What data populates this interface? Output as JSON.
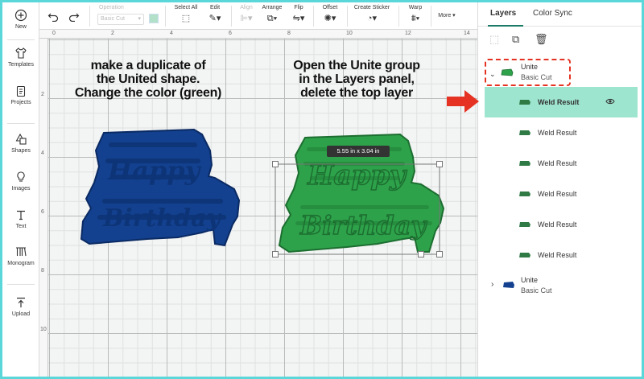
{
  "rail": {
    "new": "New",
    "templates": "Templates",
    "projects": "Projects",
    "shapes": "Shapes",
    "images": "Images",
    "text": "Text",
    "monogram": "Monogram",
    "upload": "Upload"
  },
  "toolbar": {
    "operation_label": "Operation",
    "operation_value": "Basic Cut",
    "select_all": "Select All",
    "edit": "Edit",
    "align": "Align",
    "arrange": "Arrange",
    "flip": "Flip",
    "offset": "Offset",
    "create_sticker": "Create Sticker",
    "warp": "Warp",
    "more": "More ▾"
  },
  "ruler": {
    "top": [
      "0",
      "2",
      "4",
      "6",
      "8",
      "10",
      "12",
      "14"
    ],
    "left": [
      "2",
      "4",
      "6",
      "8",
      "10"
    ]
  },
  "canvas": {
    "instruction_left": [
      "make a duplicate of",
      "the United shape.",
      "Change the color (green)"
    ],
    "instruction_right": [
      "Open the Unite group",
      "in the Layers panel,",
      "delete the top layer"
    ],
    "dimension_tooltip": "5.55  in x 3.04  in",
    "design_word_1": "Happy",
    "design_word_2": "Birthday"
  },
  "colors": {
    "navy": "#13418f",
    "green": "#2ea24a",
    "highlight": "#9ee5cf",
    "accent": "#1a7a66",
    "annotation_red": "#e53222"
  },
  "panel": {
    "tab_layers": "Layers",
    "tab_color_sync": "Color Sync",
    "group1": {
      "name": "Unite",
      "sub": "Basic Cut"
    },
    "weld_results": [
      "Weld Result",
      "Weld Result",
      "Weld Result",
      "Weld Result",
      "Weld Result",
      "Weld Result"
    ],
    "group2": {
      "name": "Unite",
      "sub": "Basic Cut"
    }
  }
}
